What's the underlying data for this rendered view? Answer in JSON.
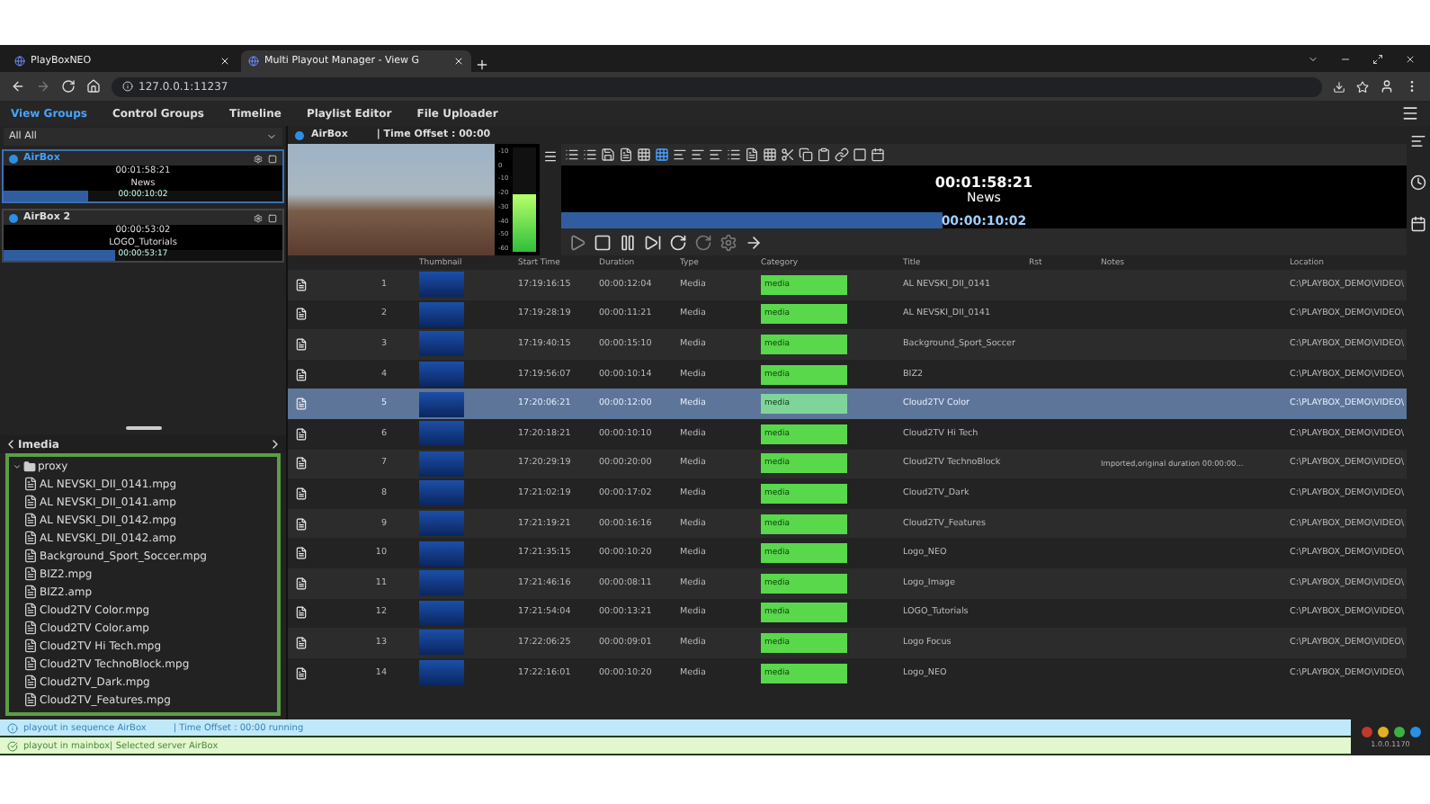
{
  "browser": {
    "tabs": [
      {
        "title": "PlayBoxNEO",
        "selected": false
      },
      {
        "title": "Multi Playout Manager - View G",
        "selected": true
      }
    ],
    "url": "127.0.0.1:11237"
  },
  "nav": [
    {
      "label": "View Groups",
      "selected": true
    },
    {
      "label": "Control Groups",
      "selected": false
    },
    {
      "label": "Timeline",
      "selected": false
    },
    {
      "label": "Playlist Editor",
      "selected": false
    },
    {
      "label": "File Uploader",
      "selected": false
    }
  ],
  "group_select": {
    "value": "All All"
  },
  "servers": [
    {
      "name": "AirBox",
      "selected": true,
      "clock": "00:01:58:21",
      "title": "News",
      "remaining": "00:00:10:02",
      "level": 0.3
    },
    {
      "name": "AirBox 2",
      "selected": false,
      "clock": "00:00:53:02",
      "title": "LOGO_Tutorials",
      "remaining": "00:00:53:17",
      "level": 0.4
    }
  ],
  "media_panel": {
    "title": "Imedia",
    "tree": [
      {
        "name": "proxy",
        "kind": "folder",
        "expanded": true,
        "children": [
          {
            "name": "AL NEVSKI_DII_0141.mpg",
            "kind": "file"
          },
          {
            "name": "AL NEVSKI_DII_0141.amp",
            "kind": "file"
          },
          {
            "name": "AL NEVSKI_DII_0142.mpg",
            "kind": "file"
          },
          {
            "name": "AL NEVSKI_DII_0142.amp",
            "kind": "file"
          },
          {
            "name": "Background_Sport_Soccer.mpg",
            "kind": "file"
          },
          {
            "name": "BIZ2.mpg",
            "kind": "file"
          },
          {
            "name": "BIZ2.amp",
            "kind": "file"
          },
          {
            "name": "Cloud2TV Color.mpg",
            "kind": "file"
          },
          {
            "name": "Cloud2TV Color.amp",
            "kind": "file"
          },
          {
            "name": "Cloud2TV Hi Tech.mpg",
            "kind": "file"
          },
          {
            "name": "Cloud2TV TechnoBlock.mpg",
            "kind": "file"
          },
          {
            "name": "Cloud2TV_Dark.mpg",
            "kind": "file"
          },
          {
            "name": "Cloud2TV_Features.mpg",
            "kind": "file"
          }
        ]
      }
    ]
  },
  "player": {
    "server": "AirBox",
    "offset": "| Time Offset : 00:00",
    "clock": "00:01:58:21",
    "title": "News",
    "remaining": "00:00:10:02",
    "level": 0.45,
    "meter": {
      "level": 0.55,
      "ticks": [
        "-10",
        "0",
        "-10",
        "-20",
        "-30",
        "-40",
        "-50",
        "-60"
      ]
    }
  },
  "table": {
    "columns": [
      "Thumbnail",
      "Start Time",
      "Duration",
      "Type",
      "Category",
      "Title",
      "Rst",
      "Notes",
      "Location"
    ],
    "rows": [
      {
        "number": "1",
        "start": "17:19:16:15",
        "duration": "00:00:12:04",
        "type": "Media",
        "category": "media",
        "title": "AL NEVSKI_DII_0141",
        "location": "C:\\PLAYBOX_DEMO\\VIDEO\\",
        "selected": false
      },
      {
        "number": "2",
        "start": "17:19:28:19",
        "duration": "00:00:11:21",
        "type": "Media",
        "category": "media",
        "title": "AL NEVSKI_DII_0141",
        "location": "C:\\PLAYBOX_DEMO\\VIDEO\\",
        "selected": false
      },
      {
        "number": "3",
        "start": "17:19:40:15",
        "duration": "00:00:15:10",
        "type": "Media",
        "category": "media",
        "title": "Background_Sport_Soccer",
        "location": "C:\\PLAYBOX_DEMO\\VIDEO\\",
        "selected": false
      },
      {
        "number": "4",
        "start": "17:19:56:07",
        "duration": "00:00:10:14",
        "type": "Media",
        "category": "media",
        "title": "BIZ2",
        "location": "C:\\PLAYBOX_DEMO\\VIDEO\\",
        "selected": false
      },
      {
        "number": "5",
        "start": "17:20:06:21",
        "duration": "00:00:12:00",
        "type": "Media",
        "category": "media",
        "title": "Cloud2TV Color",
        "location": "C:\\PLAYBOX_DEMO\\VIDEO\\",
        "selected": true
      },
      {
        "number": "6",
        "start": "17:20:18:21",
        "duration": "00:00:10:10",
        "type": "Media",
        "category": "media",
        "title": "Cloud2TV Hi Tech",
        "location": "C:\\PLAYBOX_DEMO\\VIDEO\\",
        "selected": false
      },
      {
        "number": "7",
        "start": "17:20:29:19",
        "duration": "00:00:20:00",
        "type": "Media",
        "category": "media",
        "title": "Cloud2TV TechnoBlock",
        "notes": "Imported,original duration 00:00:00...",
        "location": "C:\\PLAYBOX_DEMO\\VIDEO\\",
        "selected": false
      },
      {
        "number": "8",
        "start": "17:21:02:19",
        "duration": "00:00:17:02",
        "type": "Media",
        "category": "media",
        "title": "Cloud2TV_Dark",
        "location": "C:\\PLAYBOX_DEMO\\VIDEO\\",
        "selected": false
      },
      {
        "number": "9",
        "start": "17:21:19:21",
        "duration": "00:00:16:16",
        "type": "Media",
        "category": "media",
        "title": "Cloud2TV_Features",
        "location": "C:\\PLAYBOX_DEMO\\VIDEO\\",
        "selected": false
      },
      {
        "number": "10",
        "start": "17:21:35:15",
        "duration": "00:00:10:20",
        "type": "Media",
        "category": "media",
        "title": "Logo_NEO",
        "location": "C:\\PLAYBOX_DEMO\\VIDEO\\",
        "selected": false
      },
      {
        "number": "11",
        "start": "17:21:46:16",
        "duration": "00:00:08:11",
        "type": "Media",
        "category": "media",
        "title": "Logo_Image",
        "location": "C:\\PLAYBOX_DEMO\\VIDEO\\",
        "selected": false
      },
      {
        "number": "12",
        "start": "17:21:54:04",
        "duration": "00:00:13:21",
        "type": "Media",
        "category": "media",
        "title": "LOGO_Tutorials",
        "location": "C:\\PLAYBOX_DEMO\\VIDEO\\",
        "selected": false
      },
      {
        "number": "13",
        "start": "17:22:06:25",
        "duration": "00:00:09:01",
        "type": "Media",
        "category": "media",
        "title": "Logo Focus",
        "location": "C:\\PLAYBOX_DEMO\\VIDEO\\",
        "selected": false
      },
      {
        "number": "14",
        "start": "17:22:16:01",
        "duration": "00:00:10:20",
        "type": "Media",
        "category": "media",
        "title": "Logo_NEO",
        "location": "C:\\PLAYBOX_DEMO\\VIDEO\\",
        "selected": false
      }
    ]
  },
  "messages": [
    {
      "kind": "info",
      "text": "playout in sequence AirBox",
      "extra": "| Time Offset : 00:00 running"
    },
    {
      "kind": "success",
      "text": "playout in mainbox| Selected server AirBox"
    }
  ],
  "version": "1.0.0.1170"
}
